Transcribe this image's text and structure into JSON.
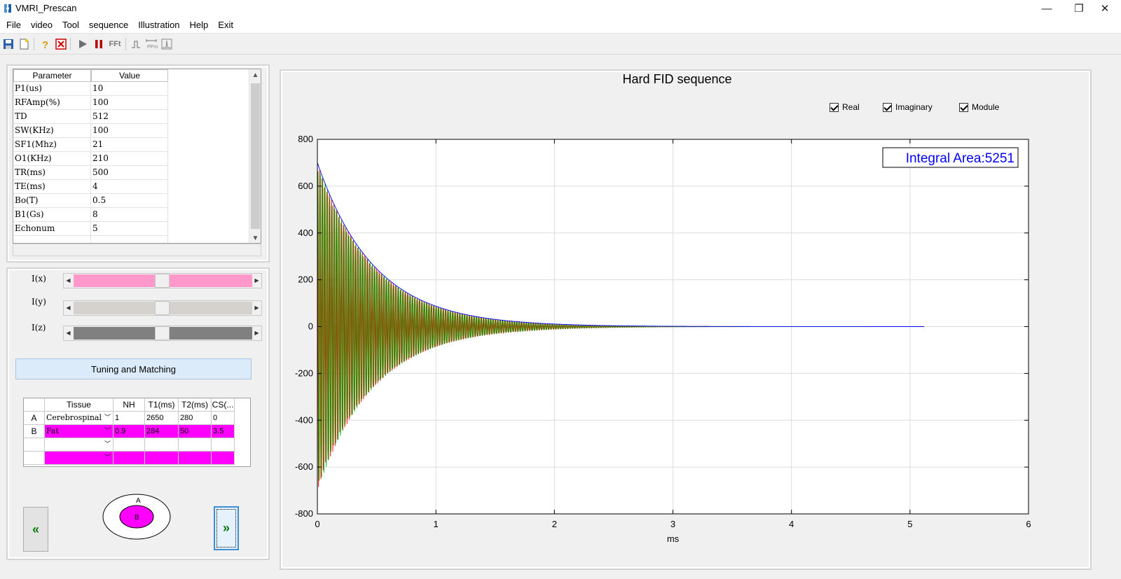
{
  "window": {
    "title": "VMRI_Prescan",
    "min_glyph": "—",
    "restore_glyph": "❐",
    "close_glyph": "✕"
  },
  "menu": [
    "File",
    "video",
    "Tool",
    "sequence",
    "Illustration",
    "Help",
    "Exit"
  ],
  "toolbar": {
    "fft_label": "FFt"
  },
  "params": {
    "headers": [
      "Parameter",
      "Value"
    ],
    "rows": [
      [
        "P1(us)",
        "10"
      ],
      [
        "RFAmp(%)",
        "100"
      ],
      [
        "TD",
        "512"
      ],
      [
        "SW(KHz)",
        "100"
      ],
      [
        "SF1(Mhz)",
        "21"
      ],
      [
        "O1(KHz)",
        "210"
      ],
      [
        "TR(ms)",
        "500"
      ],
      [
        "TE(ms)",
        "4"
      ],
      [
        "Bo(T)",
        "0.5"
      ],
      [
        "B1(Gs)",
        "8"
      ],
      [
        "Echonum",
        "5"
      ]
    ]
  },
  "sliders": [
    {
      "label": "I(x)",
      "color": "#ff99cc",
      "value": 0.5
    },
    {
      "label": "I(y)",
      "color": "#d5d1cc",
      "value": 0.5
    },
    {
      "label": "I(z)",
      "color": "#808080",
      "value": 0.5
    }
  ],
  "tuning_button": "Tuning and Matching",
  "tissue": {
    "headers": [
      "",
      "Tissue",
      "NH",
      "T1(ms)",
      "T2(ms)",
      "CS(..."
    ],
    "rows": [
      {
        "id": "A",
        "tissue": "Cerebrospinal",
        "nh": "1",
        "t1": "2650",
        "t2": "280",
        "cs": "0",
        "magenta": false
      },
      {
        "id": "B",
        "tissue": "Fat",
        "nh": "0.9",
        "t1": "284",
        "t2": "50",
        "cs": "3.5",
        "magenta": true
      },
      {
        "id": "",
        "tissue": "",
        "nh": "",
        "t1": "",
        "t2": "",
        "cs": "",
        "magenta": false
      },
      {
        "id": "",
        "tissue": "",
        "nh": "",
        "t1": "",
        "t2": "",
        "cs": "",
        "magenta": true
      }
    ],
    "magenta_color": "#ff00ff"
  },
  "nav": {
    "prev": "«",
    "next": "»"
  },
  "phantom": {
    "outer_label": "A",
    "inner_label": "B",
    "inner_color": "#ff00ff"
  },
  "plot": {
    "title": "Hard FID sequence",
    "checkboxes": [
      {
        "label": "Real",
        "checked": true
      },
      {
        "label": "Imaginary",
        "checked": true
      },
      {
        "label": "Module",
        "checked": true
      }
    ],
    "integral_label": "Integral Area:5251",
    "integral_color": "#0000ff"
  },
  "chart_data": {
    "type": "line",
    "xlabel": "ms",
    "ylabel": "",
    "xlim": [
      0,
      6
    ],
    "ylim": [
      -800,
      800
    ],
    "xticks": [
      0,
      1,
      2,
      3,
      4,
      5,
      6
    ],
    "yticks": [
      800,
      600,
      400,
      200,
      0,
      -200,
      -400,
      -600,
      -800
    ],
    "grid": true,
    "signal": {
      "amplitude": 700,
      "t_end_ms": 5.12,
      "decay_tau_ms": 0.48,
      "oscillation_freq_khz": 50
    },
    "series": [
      {
        "name": "Real",
        "color": "#ff0000"
      },
      {
        "name": "Imaginary",
        "color": "#00aa00"
      },
      {
        "name": "Module",
        "color": "#0000ff"
      }
    ]
  }
}
